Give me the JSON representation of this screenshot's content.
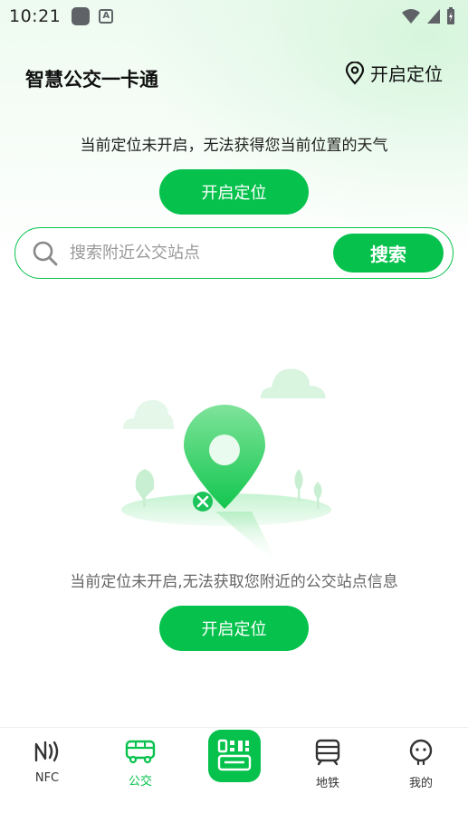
{
  "status_bar": {
    "time": "10:21"
  },
  "header": {
    "title": "智慧公交一卡通",
    "location_button": "开启定位"
  },
  "weather": {
    "message": "当前定位未开启，无法获得您当前位置的天气",
    "enable_button": "开启定位"
  },
  "search": {
    "placeholder": "搜索附近公交站点",
    "value": "",
    "button": "搜索"
  },
  "empty_state": {
    "message": "当前定位未开启,无法获取您附近的公交站点信息",
    "enable_button": "开启定位"
  },
  "tabs": [
    {
      "label": "NFC",
      "icon": "nfc-icon",
      "active": false
    },
    {
      "label": "公交",
      "icon": "bus-icon",
      "active": true
    },
    {
      "label": "",
      "icon": "qr-scan-icon",
      "active": false
    },
    {
      "label": "地铁",
      "icon": "metro-icon",
      "active": false
    },
    {
      "label": "我的",
      "icon": "profile-icon",
      "active": false
    }
  ],
  "colors": {
    "accent": "#06c24c"
  }
}
